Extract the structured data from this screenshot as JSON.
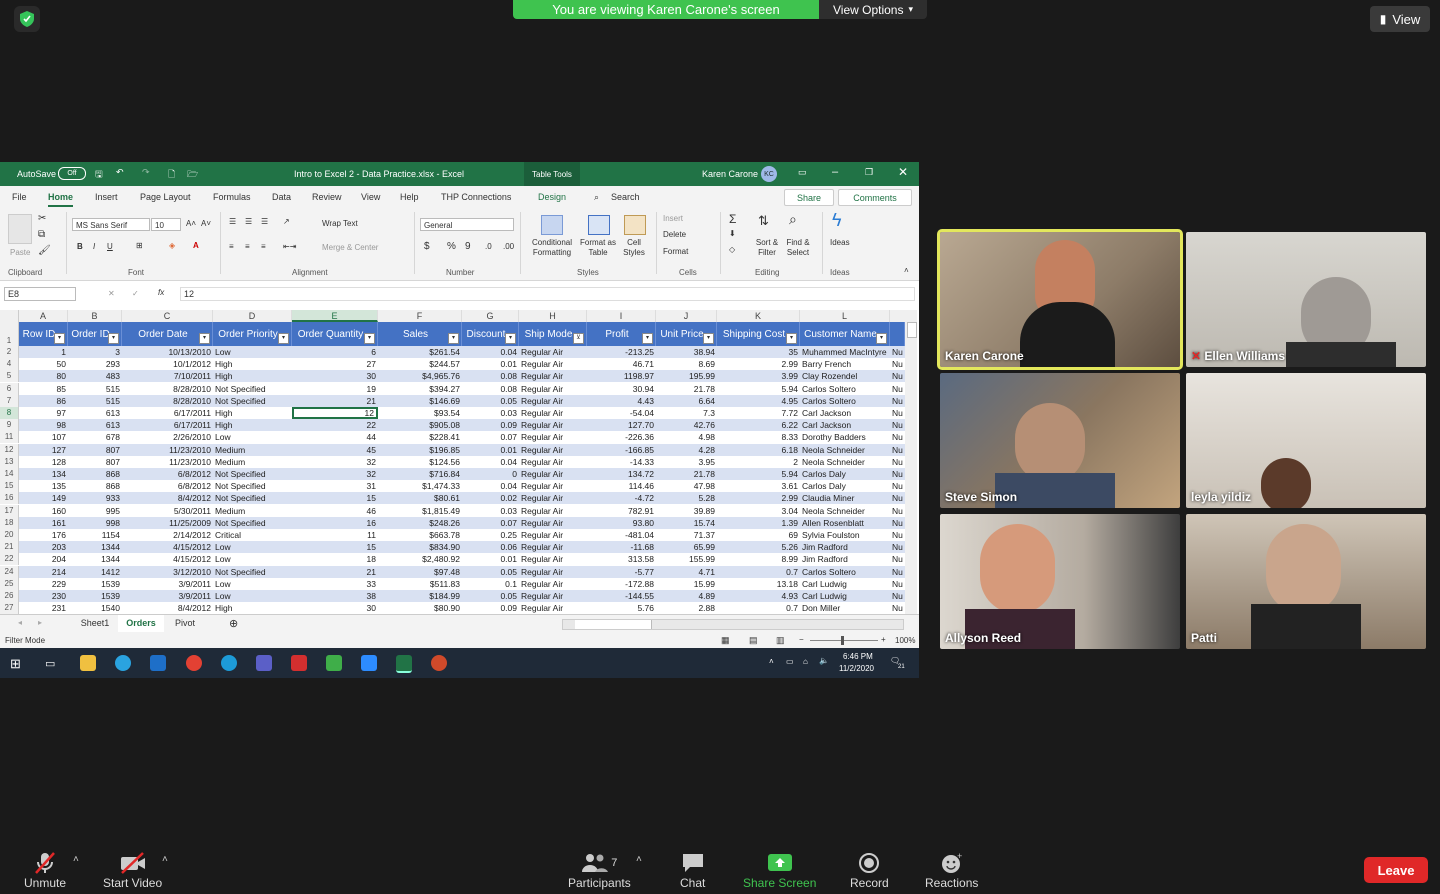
{
  "zoom": {
    "banner": "You are viewing Karen Carone's screen",
    "view_options": "View Options",
    "view_button": "View"
  },
  "excel": {
    "autosave": "AutoSave",
    "autosave_state": "Off",
    "filename": "Intro to Excel 2 - Data Practice.xlsx - Excel",
    "table_tools": "Table Tools",
    "user": "Karen Carone",
    "user_initials": "KC",
    "menu": [
      "File",
      "Home",
      "Insert",
      "Page Layout",
      "Formulas",
      "Data",
      "Review",
      "View",
      "Help",
      "THP Connections",
      "Design"
    ],
    "search": "Search",
    "share": "Share",
    "comments": "Comments",
    "ribbon": {
      "clipboard": "Clipboard",
      "paste": "Paste",
      "font": "Font",
      "font_name": "MS Sans Serif",
      "font_size": "10",
      "alignment": "Alignment",
      "wrap_text": "Wrap Text",
      "merge_center": "Merge & Center",
      "number": "Number",
      "number_format": "General",
      "styles": "Styles",
      "conditional_formatting": "Conditional Formatting",
      "format_as_table": "Format as Table",
      "cell_styles": "Cell Styles",
      "cells": "Cells",
      "insert": "Insert",
      "delete": "Delete",
      "format": "Format",
      "editing": "Editing",
      "sort_filter": "Sort & Filter",
      "find_select": "Find & Select",
      "ideas_group": "Ideas",
      "ideas": "Ideas"
    },
    "name_box": "E8",
    "formula": "12",
    "fx": "fx",
    "columns": [
      "A",
      "B",
      "C",
      "D",
      "E",
      "F",
      "G",
      "H",
      "I",
      "J",
      "K",
      "L"
    ],
    "headers": [
      "Row ID",
      "Order ID",
      "Order Date",
      "Order Priority",
      "Order Quantity",
      "Sales",
      "Discount",
      "Ship Mode",
      "Profit",
      "Unit Price",
      "Shipping Cost",
      "Customer Name"
    ],
    "row_numbers": [
      "1",
      "2",
      "4",
      "5",
      "6",
      "7",
      "8",
      "9",
      "11",
      "12",
      "13",
      "14",
      "15",
      "16",
      "17",
      "18",
      "20",
      "21",
      "22",
      "24",
      "25",
      "26",
      "27"
    ],
    "rows": [
      [
        "1",
        "3",
        "10/13/2010",
        "Low",
        "6",
        "$261.54",
        "0.04",
        "Regular Air",
        "-213.25",
        "38.94",
        "35",
        "Muhammed MacIntyre",
        "Nu"
      ],
      [
        "50",
        "293",
        "10/1/2012",
        "High",
        "27",
        "$244.57",
        "0.01",
        "Regular Air",
        "46.71",
        "8.69",
        "2.99",
        "Barry French",
        "Nu"
      ],
      [
        "80",
        "483",
        "7/10/2011",
        "High",
        "30",
        "$4,965.76",
        "0.08",
        "Regular Air",
        "1198.97",
        "195.99",
        "3.99",
        "Clay Rozendel",
        "Nu"
      ],
      [
        "85",
        "515",
        "8/28/2010",
        "Not Specified",
        "19",
        "$394.27",
        "0.08",
        "Regular Air",
        "30.94",
        "21.78",
        "5.94",
        "Carlos Soltero",
        "Nu"
      ],
      [
        "86",
        "515",
        "8/28/2010",
        "Not Specified",
        "21",
        "$146.69",
        "0.05",
        "Regular Air",
        "4.43",
        "6.64",
        "4.95",
        "Carlos Soltero",
        "Nu"
      ],
      [
        "97",
        "613",
        "6/17/2011",
        "High",
        "12",
        "$93.54",
        "0.03",
        "Regular Air",
        "-54.04",
        "7.3",
        "7.72",
        "Carl Jackson",
        "Nu"
      ],
      [
        "98",
        "613",
        "6/17/2011",
        "High",
        "22",
        "$905.08",
        "0.09",
        "Regular Air",
        "127.70",
        "42.76",
        "6.22",
        "Carl Jackson",
        "Nu"
      ],
      [
        "107",
        "678",
        "2/26/2010",
        "Low",
        "44",
        "$228.41",
        "0.07",
        "Regular Air",
        "-226.36",
        "4.98",
        "8.33",
        "Dorothy Badders",
        "Nu"
      ],
      [
        "127",
        "807",
        "11/23/2010",
        "Medium",
        "45",
        "$196.85",
        "0.01",
        "Regular Air",
        "-166.85",
        "4.28",
        "6.18",
        "Neola Schneider",
        "Nu"
      ],
      [
        "128",
        "807",
        "11/23/2010",
        "Medium",
        "32",
        "$124.56",
        "0.04",
        "Regular Air",
        "-14.33",
        "3.95",
        "2",
        "Neola Schneider",
        "Nu"
      ],
      [
        "134",
        "868",
        "6/8/2012",
        "Not Specified",
        "32",
        "$716.84",
        "0",
        "Regular Air",
        "134.72",
        "21.78",
        "5.94",
        "Carlos Daly",
        "Nu"
      ],
      [
        "135",
        "868",
        "6/8/2012",
        "Not Specified",
        "31",
        "$1,474.33",
        "0.04",
        "Regular Air",
        "114.46",
        "47.98",
        "3.61",
        "Carlos Daly",
        "Nu"
      ],
      [
        "149",
        "933",
        "8/4/2012",
        "Not Specified",
        "15",
        "$80.61",
        "0.02",
        "Regular Air",
        "-4.72",
        "5.28",
        "2.99",
        "Claudia Miner",
        "Nu"
      ],
      [
        "160",
        "995",
        "5/30/2011",
        "Medium",
        "46",
        "$1,815.49",
        "0.03",
        "Regular Air",
        "782.91",
        "39.89",
        "3.04",
        "Neola Schneider",
        "Nu"
      ],
      [
        "161",
        "998",
        "11/25/2009",
        "Not Specified",
        "16",
        "$248.26",
        "0.07",
        "Regular Air",
        "93.80",
        "15.74",
        "1.39",
        "Allen Rosenblatt",
        "Nu"
      ],
      [
        "176",
        "1154",
        "2/14/2012",
        "Critical",
        "11",
        "$663.78",
        "0.25",
        "Regular Air",
        "-481.04",
        "71.37",
        "69",
        "Sylvia Foulston",
        "Nu"
      ],
      [
        "203",
        "1344",
        "4/15/2012",
        "Low",
        "15",
        "$834.90",
        "0.06",
        "Regular Air",
        "-11.68",
        "65.99",
        "5.26",
        "Jim Radford",
        "Nu"
      ],
      [
        "204",
        "1344",
        "4/15/2012",
        "Low",
        "18",
        "$2,480.92",
        "0.01",
        "Regular Air",
        "313.58",
        "155.99",
        "8.99",
        "Jim Radford",
        "Nu"
      ],
      [
        "214",
        "1412",
        "3/12/2010",
        "Not Specified",
        "21",
        "$97.48",
        "0.05",
        "Regular Air",
        "-5.77",
        "4.71",
        "0.7",
        "Carlos Soltero",
        "Nu"
      ],
      [
        "229",
        "1539",
        "3/9/2011",
        "Low",
        "33",
        "$511.83",
        "0.1",
        "Regular Air",
        "-172.88",
        "15.99",
        "13.18",
        "Carl Ludwig",
        "Nu"
      ],
      [
        "230",
        "1539",
        "3/9/2011",
        "Low",
        "38",
        "$184.99",
        "0.05",
        "Regular Air",
        "-144.55",
        "4.89",
        "4.93",
        "Carl Ludwig",
        "Nu"
      ],
      [
        "231",
        "1540",
        "8/4/2012",
        "High",
        "30",
        "$80.90",
        "0.09",
        "Regular Air",
        "5.76",
        "2.88",
        "0.7",
        "Don Miller",
        "Nu"
      ]
    ],
    "sheets": [
      "Sheet1",
      "Orders",
      "Pivot"
    ],
    "active_sheet": "Orders",
    "status": "Filter Mode",
    "zoom_level": "100%",
    "time": "6:46 PM",
    "date": "11/2/2020",
    "notifications": "21"
  },
  "participants": [
    {
      "name": "Karen Carone",
      "speaking": true
    },
    {
      "name": "Ellen Williams",
      "muted": true
    },
    {
      "name": "Steve Simon"
    },
    {
      "name": "leyla yildiz"
    },
    {
      "name": "Allyson Reed"
    },
    {
      "name": "Patti"
    }
  ],
  "controls": {
    "unmute": "Unmute",
    "start_video": "Start Video",
    "participants": "Participants",
    "participants_count": "7",
    "chat": "Chat",
    "share_screen": "Share Screen",
    "record": "Record",
    "reactions": "Reactions",
    "leave": "Leave"
  },
  "colors": {
    "banner_green": "#3fc34f",
    "excel_green": "#217346",
    "table_header": "#4472c4",
    "leave_red": "#e02828",
    "speaker_outline": "#e3e75c"
  }
}
